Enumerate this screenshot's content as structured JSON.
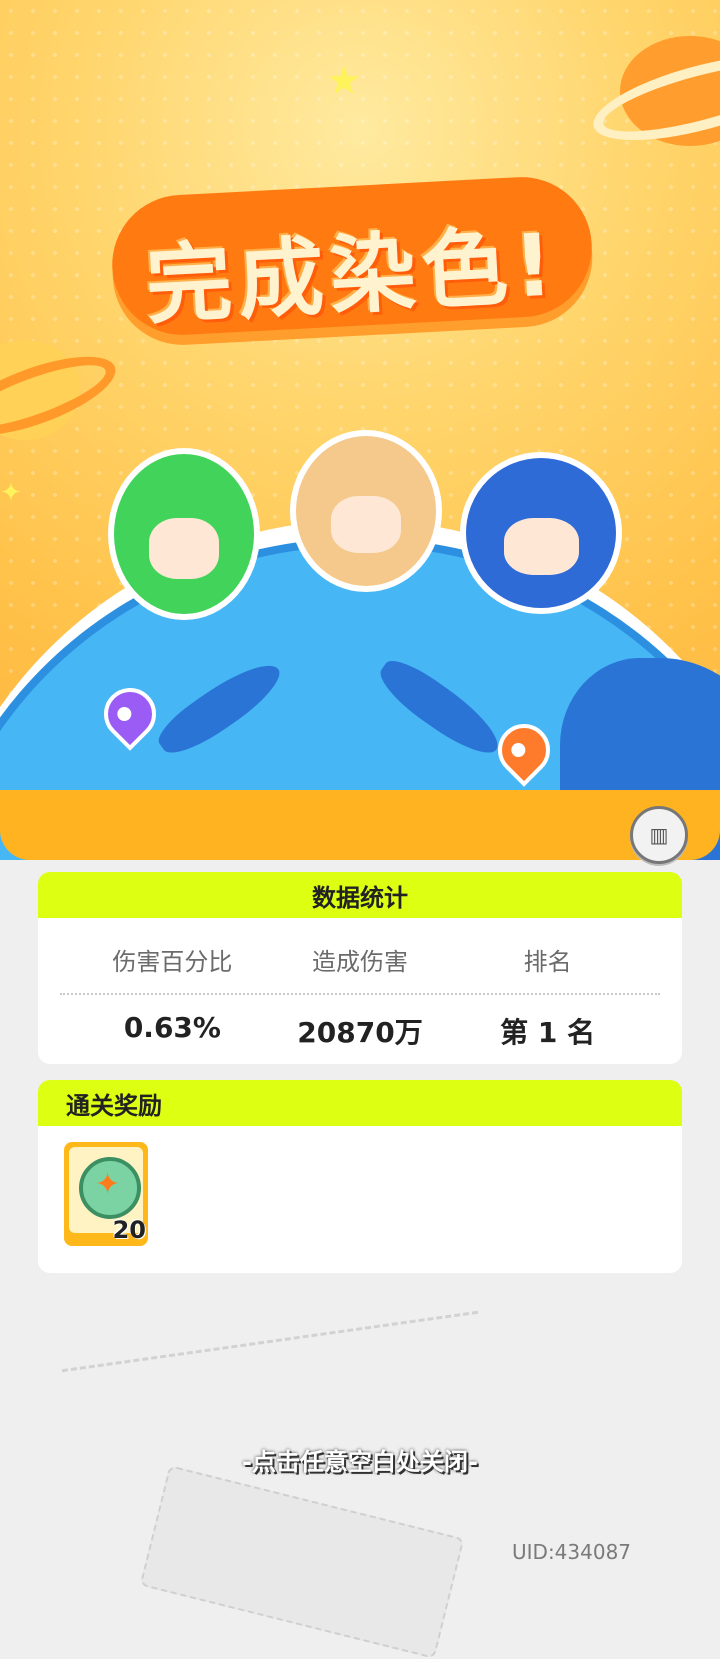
{
  "hero": {
    "title": "完成染色!"
  },
  "stats": {
    "header": "数据统计",
    "columns": [
      "伤害百分比",
      "造成伤害",
      "排名"
    ],
    "values": [
      "0.63%",
      "20870万",
      "第 1 名"
    ]
  },
  "reward": {
    "header": "通关奖励",
    "items": [
      {
        "icon": "bottle-cap-icon",
        "count": "20"
      }
    ]
  },
  "footer": {
    "close_hint": "-点击任意空白处关闭-",
    "uid": "UID:434087"
  },
  "icons": {
    "stats_button": "bar-chart-icon"
  },
  "colors": {
    "header_lime": "#dcff12",
    "hero_orange": "#ff7b12",
    "globe_blue": "#47b6f5"
  }
}
